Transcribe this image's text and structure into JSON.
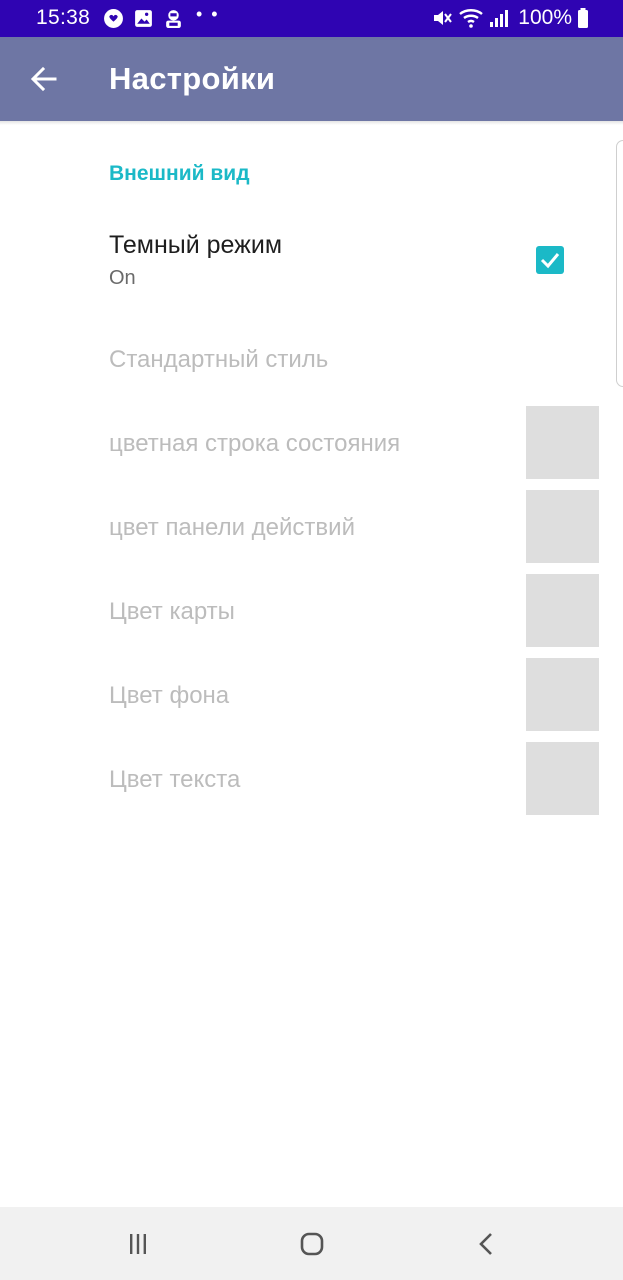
{
  "status_bar": {
    "time": "15:38",
    "notification_icons": [
      "viber-icon",
      "gallery-icon",
      "vpn-robot-icon"
    ],
    "overflow_dots": "• •",
    "system_icons": [
      "mute-icon",
      "wifi-icon",
      "signal-icon"
    ],
    "battery_text": "100%"
  },
  "app_bar": {
    "back_icon": "arrow-left-icon",
    "title": "Настройки"
  },
  "settings": {
    "section_header": "Внешний вид",
    "dark_mode": {
      "title": "Темный режим",
      "summary": "On",
      "checked": true
    },
    "standard_style": "Стандартный стиль",
    "color_items": [
      {
        "label": "цветная строка состояния"
      },
      {
        "label": "цвет панели действий"
      },
      {
        "label": "Цвет карты"
      },
      {
        "label": "Цвет фона"
      },
      {
        "label": "Цвет текста"
      }
    ]
  },
  "nav_bar": {
    "icons": [
      "recent-apps-icon",
      "home-icon",
      "back-icon"
    ]
  },
  "colors": {
    "status_bar": "#2f04b2",
    "app_bar": "#6e76a4",
    "accent": "#1bb9c7",
    "disabled_text": "#bcbcbc",
    "swatch": "#dedede"
  }
}
